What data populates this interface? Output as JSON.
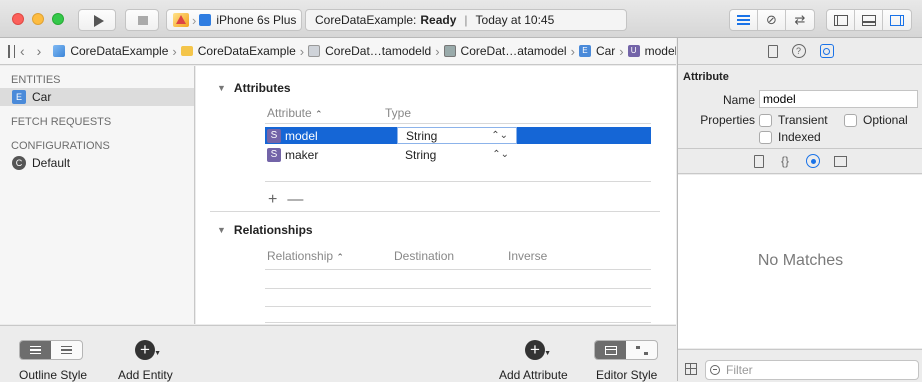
{
  "toolbar": {
    "destination": "iPhone 6s Plus",
    "status_project": "CoreDataExample:",
    "status_state": "Ready",
    "status_time": "Today at 10:45"
  },
  "jumpbar": {
    "crumbs": [
      "CoreDataExample",
      "CoreDataExample",
      "CoreDat…tamodeld",
      "CoreDat…atamodel",
      "Car",
      "model"
    ]
  },
  "outline": {
    "entities_header": "ENTITIES",
    "entities": [
      {
        "badge": "E",
        "label": "Car"
      }
    ],
    "fetch_header": "FETCH REQUESTS",
    "config_header": "CONFIGURATIONS",
    "configs": [
      {
        "badge": "C",
        "label": "Default"
      }
    ]
  },
  "attributes": {
    "title": "Attributes",
    "col_attribute": "Attribute",
    "col_type": "Type",
    "rows": [
      {
        "badge": "S",
        "name": "model",
        "type": "String"
      },
      {
        "badge": "S",
        "name": "maker",
        "type": "String"
      }
    ],
    "plus": "+",
    "minus": "—"
  },
  "relationships": {
    "title": "Relationships",
    "col_relationship": "Relationship",
    "col_destination": "Destination",
    "col_inverse": "Inverse"
  },
  "bottom": {
    "outline_style": "Outline Style",
    "add_entity": "Add Entity",
    "add_attribute": "Add Attribute",
    "editor_style": "Editor Style"
  },
  "inspector": {
    "title": "Attribute",
    "name_label": "Name",
    "name_value": "model",
    "properties_label": "Properties",
    "transient": "Transient",
    "optional": "Optional",
    "indexed": "Indexed",
    "no_matches": "No Matches",
    "filter_placeholder": "Filter"
  }
}
